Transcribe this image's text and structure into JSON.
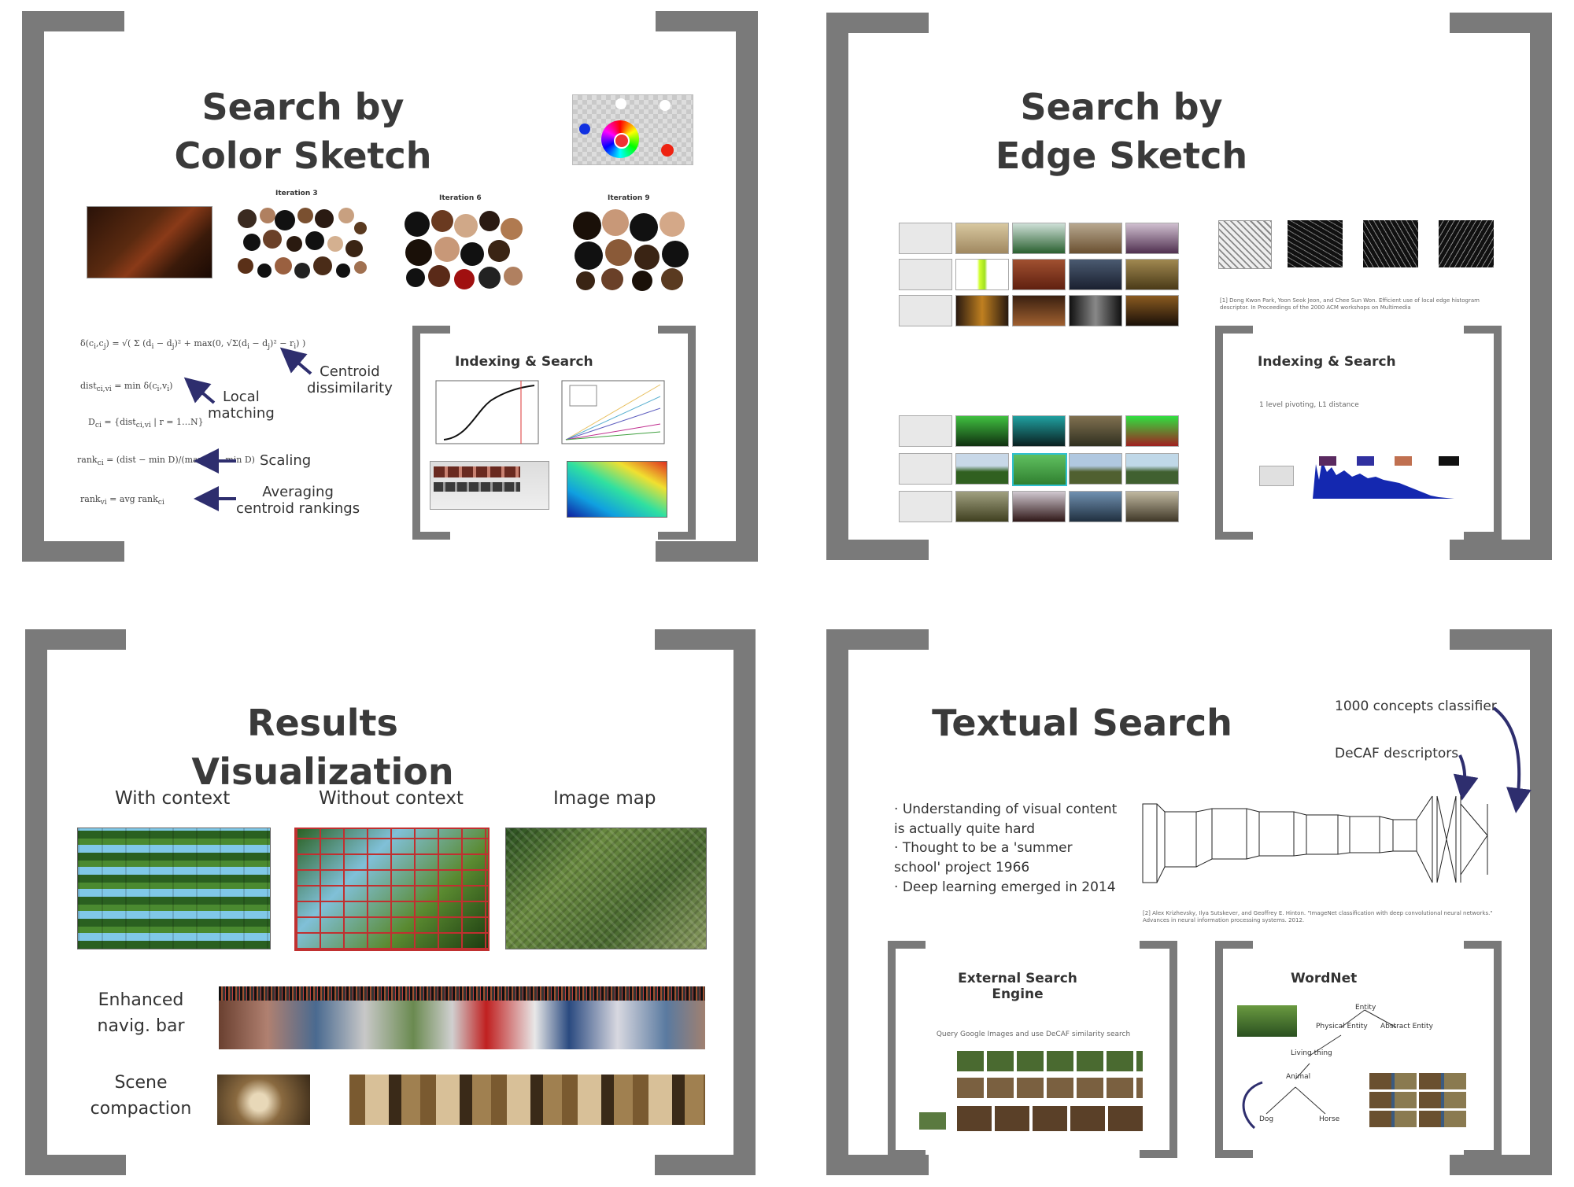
{
  "colors": {
    "bracket": "#7a7a7a",
    "arrow": "#2e2e6e",
    "text": "#333333"
  },
  "panel_color": {
    "title": "Search by\nColor Sketch",
    "iterations": [
      "Iteration 3",
      "Iteration 6",
      "Iteration 9"
    ],
    "annotations": {
      "centroid": "Centroid\ndissimilarity",
      "local": "Local\nmatching",
      "scaling": "Scaling",
      "averaging": "Averaging\ncentroid rankings"
    },
    "inset_title": "Indexing & Search"
  },
  "panel_edge": {
    "title": "Search by\nEdge Sketch",
    "reference": "[1] Dong Kwon Park, Yoon Seok Jeon, and Chee Sun Won. Efficient use of local edge histogram descriptor. In Proceedings of the 2000 ACM workshops on Multimedia",
    "inset_title": "Indexing & Search",
    "inset_caption": "1 level pivoting, L1 distance"
  },
  "panel_results": {
    "title": "Results Visualization",
    "columns": [
      "With context",
      "Without context",
      "Image map"
    ],
    "row_labels": {
      "navbar": "Enhanced\nnavig. bar",
      "scene": "Scene\ncompaction"
    }
  },
  "panel_textual": {
    "title": "Textual Search",
    "annotations": {
      "classifier": "1000 concepts classifier",
      "decaf": "DeCAF descriptors"
    },
    "bullets": [
      "Understanding of visual content\nis actually quite hard",
      "Thought to be a 'summer\nschool' project 1966",
      "Deep learning emerged in 2014"
    ],
    "reference": "[2] Alex Krizhevsky, Ilya Sutskever, and Geoffrey E. Hinton. \"ImageNet classification with deep convolutional neural networks.\" Advances in neural information processing systems. 2012.",
    "external": {
      "title": "External Search\nEngine",
      "caption": "Query Google Images and use DeCAF similarity search"
    },
    "wordnet": {
      "title": "WordNet",
      "nodes": [
        "Entity",
        "Physical Entity",
        "Abstract Entity",
        "Living thing",
        "Animal",
        "Dog",
        "Horse"
      ]
    }
  }
}
